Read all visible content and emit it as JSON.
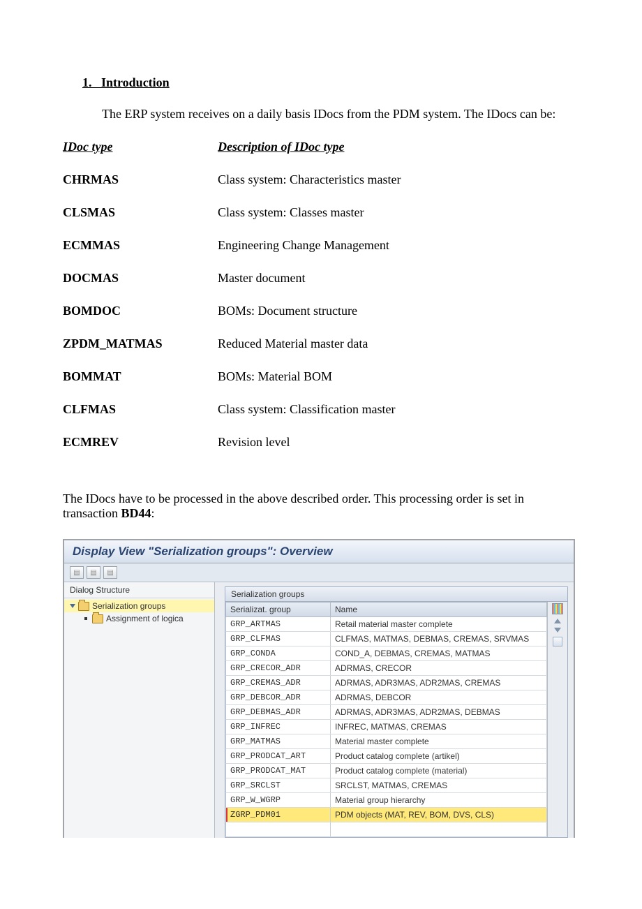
{
  "section": {
    "number": "1.",
    "title": "Introduction"
  },
  "intro_para": "The ERP system receives on a daily basis IDocs from the PDM system. The IDocs can be:",
  "idoc_table": {
    "header_type": "IDoc type",
    "header_desc": "Description of IDoc type",
    "rows": [
      {
        "type": "CHRMAS",
        "desc": "Class system: Characteristics master"
      },
      {
        "type": "CLSMAS",
        "desc": "Class system: Classes master"
      },
      {
        "type": "ECMMAS",
        "desc": "Engineering Change Management"
      },
      {
        "type": "DOCMAS",
        "desc": "Master document"
      },
      {
        "type": "BOMDOC",
        "desc": "BOMs: Document structure"
      },
      {
        "type": "ZPDM_MATMAS",
        "desc": "Reduced Material master data"
      },
      {
        "type": "BOMMAT",
        "desc": "BOMs: Material BOM"
      },
      {
        "type": "CLFMAS",
        "desc": "Class system: Classification master"
      },
      {
        "type": "ECMREV",
        "desc": "Revision level"
      }
    ]
  },
  "order_para_prefix": "The IDocs have to be processed in the above described order. This processing order is set in transaction ",
  "order_para_tx": "BD44",
  "order_para_suffix": ":",
  "sap": {
    "window_title": "Display View \"Serialization groups\": Overview",
    "left_panel_title": "Dialog Structure",
    "tree": {
      "root_label": "Serialization groups",
      "child_label": "Assignment of logica"
    },
    "grid_title": "Serialization groups",
    "columns": {
      "group": "Serializat. group",
      "name": "Name"
    },
    "rows": [
      {
        "group": "GRP_ARTMAS",
        "name": "Retail material master complete",
        "hl": false
      },
      {
        "group": "GRP_CLFMAS",
        "name": "CLFMAS, MATMAS, DEBMAS, CREMAS, SRVMAS",
        "hl": false
      },
      {
        "group": "GRP_CONDA",
        "name": "COND_A, DEBMAS, CREMAS, MATMAS",
        "hl": false
      },
      {
        "group": "GRP_CRECOR_ADR",
        "name": "ADRMAS, CRECOR",
        "hl": false
      },
      {
        "group": "GRP_CREMAS_ADR",
        "name": "ADRMAS, ADR3MAS, ADR2MAS, CREMAS",
        "hl": false
      },
      {
        "group": "GRP_DEBCOR_ADR",
        "name": "ADRMAS, DEBCOR",
        "hl": false
      },
      {
        "group": "GRP_DEBMAS_ADR",
        "name": "ADRMAS, ADR3MAS, ADR2MAS, DEBMAS",
        "hl": false
      },
      {
        "group": "GRP_INFREC",
        "name": "INFREC, MATMAS, CREMAS",
        "hl": false
      },
      {
        "group": "GRP_MATMAS",
        "name": "Material master complete",
        "hl": false
      },
      {
        "group": "GRP_PRODCAT_ART",
        "name": "Product catalog complete (artikel)",
        "hl": false
      },
      {
        "group": "GRP_PRODCAT_MAT",
        "name": "Product catalog complete (material)",
        "hl": false
      },
      {
        "group": "GRP_SRCLST",
        "name": "SRCLST, MATMAS, CREMAS",
        "hl": false
      },
      {
        "group": "GRP_W_WGRP",
        "name": "Material group hierarchy",
        "hl": false
      },
      {
        "group": "ZGRP_PDM01",
        "name": "PDM objects (MAT, REV, BOM, DVS, CLS)",
        "hl": true
      }
    ]
  }
}
